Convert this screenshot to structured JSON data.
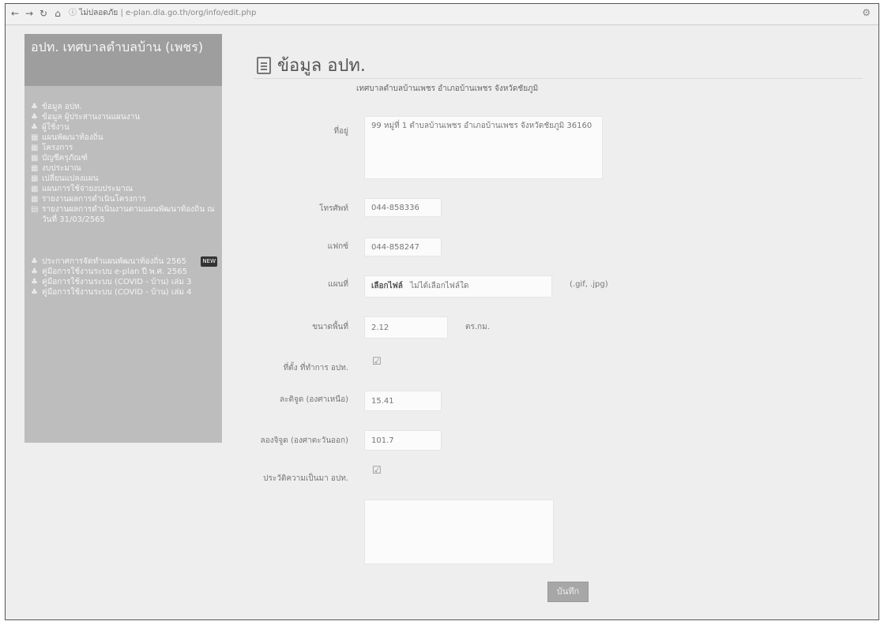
{
  "browser": {
    "back_icon": "back-arrow-icon",
    "url_host": "ไม่ปลอดภัย",
    "url_path": "e-plan.dla.go.th/org/info/edit.php"
  },
  "sidebar": {
    "title": "อปท. เทศบาลตำบลบ้าน (เพชร)",
    "items": [
      {
        "icon": "user-icon",
        "label": "ข้อมูล อปท."
      },
      {
        "icon": "user-icon",
        "label": "ข้อมูล ผู้ประสานงานแผนงาน"
      },
      {
        "icon": "user-icon",
        "label": "ผู้ใช้งาน"
      },
      {
        "icon": "report-icon",
        "label": "แผนพัฒนาท้องถิ่น"
      },
      {
        "icon": "report-icon",
        "label": "โครงการ"
      },
      {
        "icon": "report-icon",
        "label": "บัญชีครุภัณฑ์"
      },
      {
        "icon": "report-icon",
        "label": "งบประมาณ"
      },
      {
        "icon": "report-icon",
        "label": "เปลี่ยนแปลงแผน"
      },
      {
        "icon": "report-icon",
        "label": "แผนการใช้จ่ายงบประมาณ"
      },
      {
        "icon": "report-icon",
        "label": "รายงานผลการดำเนินโครงการ"
      },
      {
        "icon": "document-icon",
        "label": "รายงานผลการดำเนินงานตามแผนพัฒนาท้องถิ่น ณ วันที่ 31/03/2565"
      }
    ],
    "items2": [
      {
        "icon": "user-icon",
        "label": "ประกาศการจัดทำแผนพัฒนาท้องถิ่น 2565",
        "badge": "NEW"
      },
      {
        "icon": "user-icon",
        "label": "คู่มือการใช้งานระบบ e-plan ปี พ.ศ. 2565"
      },
      {
        "icon": "user-icon",
        "label": "คู่มือการใช้งานระบบ (COVID - บ้าน) เล่ม 3"
      },
      {
        "icon": "user-icon",
        "label": "คู่มือการใช้งานระบบ (COVID - บ้าน) เล่ม 4"
      }
    ]
  },
  "main": {
    "title": "ข้อมูล อปท.",
    "org_name": "เทศบาลตำบลบ้านเพชร อำเภอบ้านเพชร จังหวัดชัยภูมิ",
    "fields": {
      "address_label": "ที่อยู่",
      "address_value": "99 หมู่ที่ 1 ตำบลบ้านเพชร อำเภอบ้านเพชร จังหวัดชัยภูมิ 36160",
      "phone_label": "โทรศัพท์",
      "phone_value": "044-858336",
      "fax_label": "แฟกซ์",
      "fax_value": "044-858247",
      "map_label": "แผนที่",
      "choose_file": "เลือกไฟล์",
      "no_file": "ไม่ได้เลือกไฟล์ใด",
      "file_hint": "(.gif, .jpg)",
      "area_label": "ขนาดพื้นที่",
      "area_value": "2.12",
      "area_unit": "ตร.กม.",
      "hq_label": "ที่ตั้ง ที่ทำการ อปท.",
      "lat_label": "ละติจูด (องศาเหนือ)",
      "lat_value": "15.41",
      "long_label": "ลองจิจูด (องศาตะวันออก)",
      "long_value": "101.7",
      "history_label": "ประวัติความเป็นมา อปท.",
      "history_value": ""
    },
    "save_label": "บันทึก"
  }
}
